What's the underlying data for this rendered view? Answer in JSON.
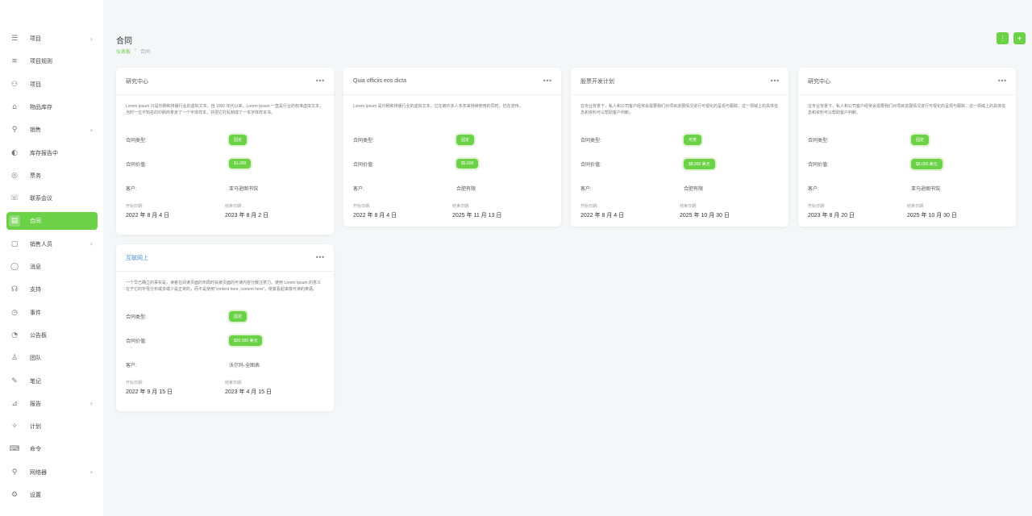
{
  "sidebar": {
    "items": [
      {
        "label": "项目",
        "icon": "☰",
        "chev": "›"
      },
      {
        "label": "项目规则",
        "icon": "≡",
        "chev": ""
      },
      {
        "label": "项目",
        "icon": "⚇",
        "chev": ""
      },
      {
        "label": "物品库存",
        "icon": "⌂",
        "chev": ""
      },
      {
        "label": "销售",
        "icon": "⚲",
        "chev": "›"
      },
      {
        "label": "库存报告中",
        "icon": "◐",
        "chev": ""
      },
      {
        "label": "票务",
        "icon": "◎",
        "chev": ""
      },
      {
        "label": "联系会议",
        "icon": "☏",
        "chev": ""
      },
      {
        "label": "合同",
        "icon": "▤",
        "chev": ""
      },
      {
        "label": "销售人员",
        "icon": "▢",
        "chev": "›"
      },
      {
        "label": "消息",
        "icon": "◯",
        "chev": ""
      },
      {
        "label": "支持",
        "icon": "☊",
        "chev": ""
      },
      {
        "label": "事件",
        "icon": "◷",
        "chev": ""
      },
      {
        "label": "公告板",
        "icon": "◔",
        "chev": ""
      },
      {
        "label": "团队",
        "icon": "♙",
        "chev": ""
      },
      {
        "label": "笔记",
        "icon": "✎",
        "chev": ""
      },
      {
        "label": "报告",
        "icon": "⊿",
        "chev": "›"
      },
      {
        "label": "计划",
        "icon": "✧",
        "chev": ""
      },
      {
        "label": "命令",
        "icon": "⌨",
        "chev": ""
      },
      {
        "label": "网络器",
        "icon": "⚲",
        "chev": "›"
      },
      {
        "label": "设置",
        "icon": "⚙",
        "chev": ""
      }
    ],
    "active_index": 8,
    "accent": "#6bd146"
  },
  "header": {
    "title": "合同",
    "breadcrumb": [
      "仪表板",
      "›",
      "合同"
    ],
    "actions": [
      "⋮",
      "+"
    ]
  },
  "labels": {
    "type": "合同类型:",
    "value": "合同价值:",
    "client": "客户:",
    "start": "开始日期:",
    "end": "结束日期:",
    "more": "•••"
  },
  "cards": [
    {
      "title": "研究中心",
      "desc": "Lorem Ipsum 只是印刷和排版行业的虚拟文本。自 1500 年代以来，Lorem Ipsum 一直是行业的标准虚拟文本，当时一位不知名的印刷商拿走了一个字体样本，并把它打乱制成了一本字体样本书。",
      "type": "固定",
      "value": "$1,000",
      "client": "亚马逊图书馆",
      "start": "2022 年 8 月 4 日",
      "end": "2023 年 8 月 2 日"
    },
    {
      "title": "Quia officiis eos dicta",
      "desc": "Lorem Ipsum 是印刷和排版行业的虚拟文本。它在被许多人多年来持续使用的同时，仍在流传。",
      "type": "固定",
      "value": "$5,000",
      "client": "合肥有限",
      "start": "2022 年 8 月 4 日",
      "end": "2025 年 11 月 13 日"
    },
    {
      "title": "股票开发计划",
      "desc": "在专业背景下，私人和公司客户经常会需要我们对项目进展情况进行可视化的呈现与跟踪，这一领域上的具体信息和资料可以帮助客户判断。",
      "type": "可变",
      "value": "$8,000 美元",
      "client": "合肥有限",
      "start": "2022 年 8 月 4 日",
      "end": "2025 年 10 月 30 日"
    },
    {
      "title": "研究中心",
      "desc": "在专业背景下，私人和公司客户经常会需要我们对项目进展情况进行可视化的呈现与跟踪，这一领域上的具体信息和资料可以帮助客户判断。",
      "type": "固定",
      "value": "$8,000 美元",
      "client": "亚马逊图书馆",
      "start": "2023 年 8 月 20 日",
      "end": "2025 年 10 月 30 日"
    },
    {
      "title": "互联网上",
      "desc": "一个早已确立的事实是，读者在阅读页面的布局时会被页面的可读内容分散注意力。使用 Lorem Ipsum 的意义在于它的字母分布或多或少是正常的，而不是使用\"content here, content here\"，使其看起来像可读的英语。",
      "type": "固定",
      "value": "$20,000 美元",
      "client": "沃尔玛-全图表",
      "start": "2022 年 9 月 15 日",
      "end": "2023 年 4 月 15 日"
    }
  ]
}
